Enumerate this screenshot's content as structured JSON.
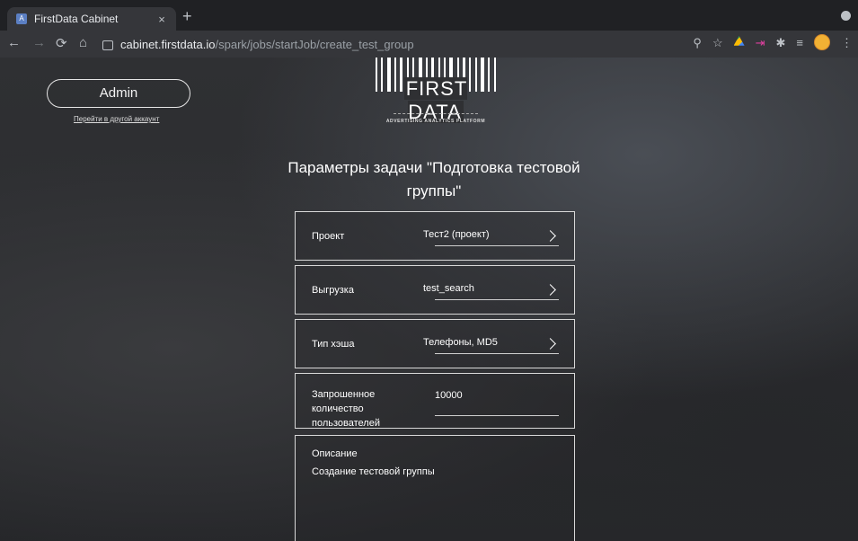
{
  "browser": {
    "tab_title": "FirstData Cabinet",
    "tab_close": "×",
    "new_tab": "+",
    "url_host": "cabinet.firstdata.io",
    "url_path": "/spark/jobs/startJob/create_test_group"
  },
  "header": {
    "account_name": "Admin",
    "switch_account_link": "Перейти в другой аккаунт",
    "logo_text": "FIRST DATA",
    "logo_tagline": "ADVERTISING ANALYTICS PLATFORM"
  },
  "form": {
    "title": "Параметры задачи \"Подготовка тестовой группы\"",
    "fields": [
      {
        "label": "Проект",
        "value": "Тест2 (проект)"
      },
      {
        "label": "Выгрузка",
        "value": "test_search"
      },
      {
        "label": "Тип хэша",
        "value": "Телефоны, MD5"
      },
      {
        "label": "Запрошенное количество пользователей",
        "value": "10000"
      }
    ],
    "description": {
      "label": "Описание",
      "value": "Создание тестовой группы"
    }
  }
}
